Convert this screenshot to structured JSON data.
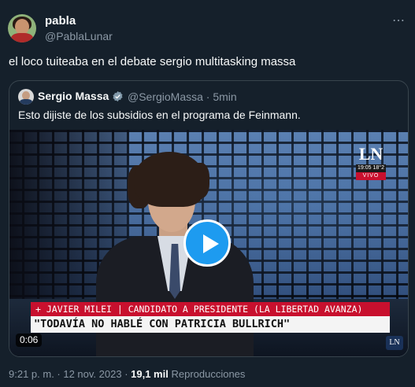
{
  "author": {
    "name": "pabla",
    "handle": "@PablaLunar"
  },
  "more_icon": "⋯",
  "tweet_text": "el loco tuiteaba en el debate sergio multitasking massa",
  "quoted": {
    "name": "Sergio Massa",
    "handle_time": "@SergioMassa · 5min",
    "text": "Esto dijiste de los subsidios en el programa de Feinmann.",
    "video": {
      "channel_logo": "LN",
      "clock": "19:05 18°2",
      "live_label": "VIVO",
      "chyron_top": "+ JAVIER MILEI | CANDIDATO A PRESIDENTE (LA LIBERTAD AVANZA)",
      "chyron_main": "\"TODAVÍA NO HABLÉ CON PATRICIA BULLRICH\"",
      "duration": "0:06",
      "watermark": "LN"
    }
  },
  "meta": {
    "timestamp": "9:21 p. m. · 12 nov. 2023",
    "separator": " · ",
    "views_count": "19,1 mil",
    "views_label": "Reproducciones"
  },
  "colors": {
    "background": "#15202b",
    "accent": "#1d9bf0",
    "chyron_red": "#c8102e"
  }
}
